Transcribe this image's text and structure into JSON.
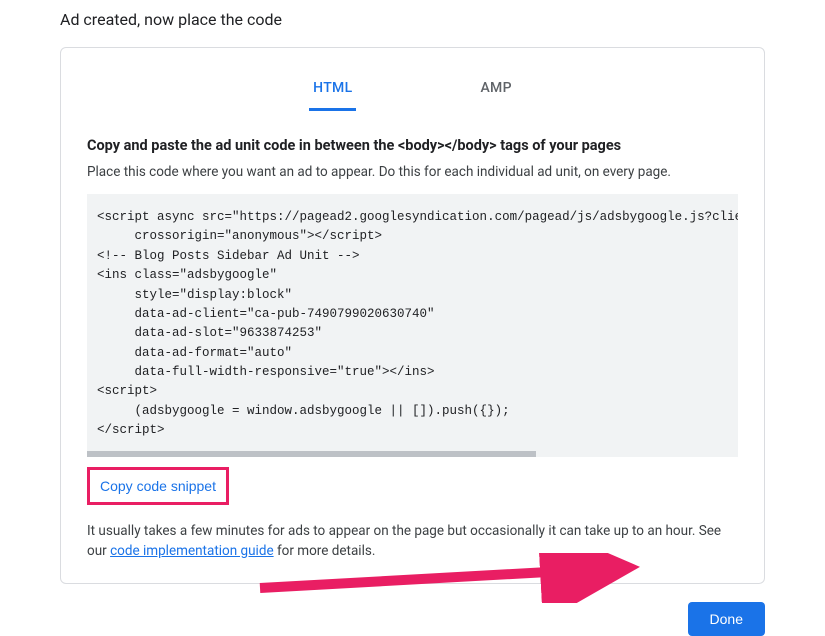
{
  "page": {
    "title": "Ad created, now place the code"
  },
  "tabs": {
    "html": "HTML",
    "amp": "AMP"
  },
  "section": {
    "heading": "Copy and paste the ad unit code in between the <body></body> tags of your pages",
    "sub": "Place this code where you want an ad to appear. Do this for each individual ad unit, on every page."
  },
  "code": "<script async src=\"https://pagead2.googlesyndication.com/pagead/js/adsbygoogle.js?client=ca-\n     crossorigin=\"anonymous\"></script>\n<!-- Blog Posts Sidebar Ad Unit -->\n<ins class=\"adsbygoogle\"\n     style=\"display:block\"\n     data-ad-client=\"ca-pub-7490799020630740\"\n     data-ad-slot=\"9633874253\"\n     data-ad-format=\"auto\"\n     data-full-width-responsive=\"true\"></ins>\n<script>\n     (adsbygoogle = window.adsbygoogle || []).push({});\n</script>",
  "buttons": {
    "copy": "Copy code snippet",
    "done": "Done"
  },
  "info": {
    "prefix": "It usually takes a few minutes for ads to appear on the page but occasionally it can take up to an hour. See our ",
    "link": "code implementation guide",
    "suffix": " for more details."
  }
}
